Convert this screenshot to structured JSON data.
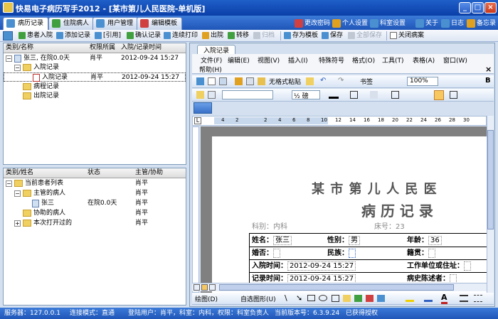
{
  "title": "快易电子病历写手2012 - [某市第儿人民医院-单机版]",
  "window_buttons": [
    "_",
    "□",
    "×"
  ],
  "tabs": [
    {
      "label": "病历记录",
      "active": true
    },
    {
      "label": "住院病人",
      "active": false
    },
    {
      "label": "用户管理",
      "active": false
    },
    {
      "label": "编辑模板",
      "active": false
    }
  ],
  "top_right": [
    "更改密码",
    "个人设置",
    "科室设置",
    "关于",
    "日志",
    "备忘录"
  ],
  "toolbar": {
    "patient_intake": "患者入院",
    "add_record": "添加记录",
    "quote": "[引用]",
    "confirm_record": "确认记录",
    "continuous_print": "连续打印",
    "discharge": "出院",
    "transfer": "转移",
    "archive": "归档",
    "save_as_template": "存为模板",
    "save": "保存",
    "save_all": "全部保存",
    "close_record": "关闭病案"
  },
  "record_tree": {
    "headers": [
      "类别/名称",
      "权限所属",
      "入院/记录时间"
    ],
    "rows": [
      {
        "name": "张三, 在院0.0天",
        "owner": "肖平",
        "time": "2012-09-24 15:27"
      },
      {
        "name": "入院记录",
        "owner": "",
        "time": ""
      },
      {
        "name": "入院记录",
        "owner": "肖平",
        "time": "2012-09-24 15:27"
      },
      {
        "name": "病程记录",
        "owner": "",
        "time": ""
      },
      {
        "name": "出院记录",
        "owner": "",
        "time": ""
      }
    ]
  },
  "patient_tree": {
    "headers": [
      "类别/姓名",
      "状态",
      "主管/协助"
    ],
    "rows": [
      {
        "name": "当前患者列表",
        "status": "",
        "doctor": "肖平"
      },
      {
        "name": "主管的病人",
        "status": "",
        "doctor": "肖平"
      },
      {
        "name": "张三",
        "status": "在院0.0天",
        "doctor": "肖平"
      },
      {
        "name": "协助的病人",
        "status": "",
        "doctor": "肖平"
      },
      {
        "name": "本次打开过的",
        "status": "",
        "doctor": "肖平"
      }
    ]
  },
  "doc_tab": "入院记录",
  "word_menu": [
    "文件(F)",
    "编辑(E)",
    "视图(V)",
    "插入(I)",
    "特殊符号",
    "格式(O)",
    "工具(T)",
    "表格(A)",
    "窗口(W)",
    "帮助(H)"
  ],
  "word_toolbar": {
    "paste_plain": "无格式粘贴",
    "bookmark": "书签",
    "zoom": "100%",
    "font_size": "½ 磅"
  },
  "ruler_numbers": [
    "4",
    "2",
    "",
    "2",
    "4",
    "6",
    "8",
    "10",
    "12",
    "14",
    "16",
    "18",
    "20",
    "22",
    "24",
    "26",
    "28",
    "30"
  ],
  "document": {
    "hospital": "某 市 第 儿 人 民 医",
    "record_title": "病 历 记 录",
    "dept_label": "科别：",
    "dept_value": "内科",
    "bed_label": "床号：",
    "bed_value": "23",
    "name_label": "姓名：",
    "name_value": "张三",
    "sex_label": "性别：",
    "sex_value": "男",
    "age_label": "年龄：",
    "age_value": "36",
    "marital_label": "婚否：",
    "ethnic_label": "民族：",
    "origin_label": "籍贯：",
    "admit_time_label": "入院时间：",
    "admit_time_value": "2012-09-24 15:27",
    "work_label": "工作单位或住址：",
    "record_time_label": "记录时间：",
    "record_time_value": "2012-09-24 15:27",
    "narrator_label": "病史陈述者："
  },
  "draw_toolbar": {
    "draw": "绘图(D)",
    "autoshape": "自选图形(U)"
  },
  "status": {
    "server": "服务器：127.0.0.1",
    "mode": "连接模式：直通",
    "user": "登陆用户：肖平，科室：内科，权限：科室负责人",
    "version": "当前版本号：6.3.9.24",
    "license": "已获得授权"
  }
}
